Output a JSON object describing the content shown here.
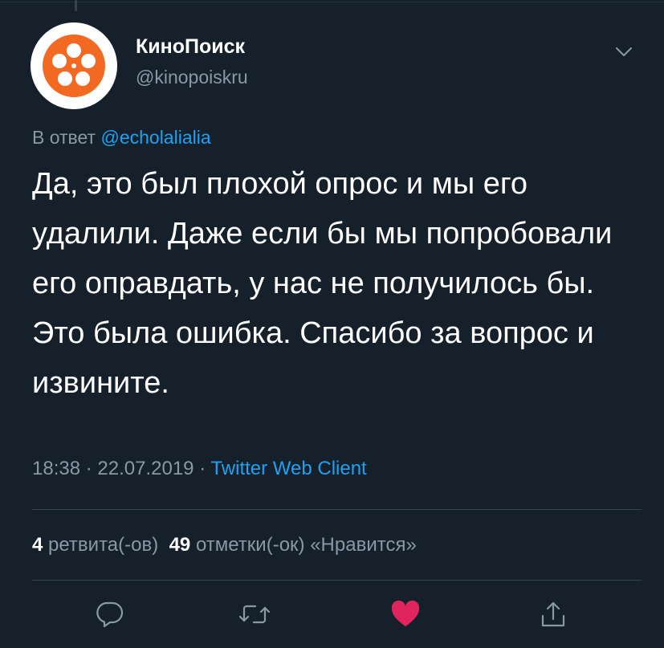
{
  "tweet": {
    "display_name": "КиноПоиск",
    "handle": "@kinopoiskru",
    "reply_prefix": "В ответ",
    "reply_to": "@echolalialia",
    "text": "Да, это был плохой опрос и мы его удалили. Даже если бы мы попробовали его оправдать, у нас не получилось бы. Это была ошибка. Спасибо за вопрос и извините.",
    "time": "18:38",
    "date": "22.07.2019",
    "separator": "·",
    "client": "Twitter Web Client"
  },
  "stats": {
    "retweets_count": "4",
    "retweets_label": "ретвита(-ов)",
    "likes_count": "49",
    "likes_label": "отметки(-ок) «Нравится»"
  },
  "icons": {
    "avatar": "kinopoisk-logo",
    "menu": "chevron-down-icon",
    "reply": "reply-icon",
    "retweet": "retweet-icon",
    "like": "heart-icon",
    "share": "share-icon"
  },
  "colors": {
    "background": "#15202b",
    "accent": "#1da1f2",
    "secondary_text": "#8899a6",
    "like": "#e0245e",
    "logo_orange": "#f26a21"
  }
}
